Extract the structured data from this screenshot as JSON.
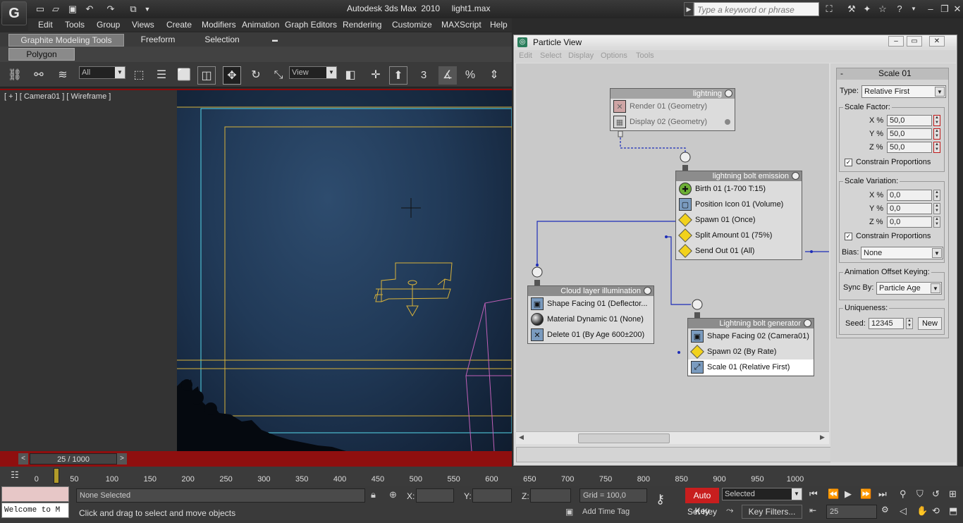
{
  "app": {
    "title": "Autodesk 3ds Max  2010     light1.max",
    "logo": "G",
    "search_placeholder": "Type a keyword or phrase"
  },
  "menu": [
    "Edit",
    "Tools",
    "Group",
    "Views",
    "Create",
    "Modifiers",
    "Animation",
    "Graph Editors",
    "Rendering",
    "Customize",
    "MAXScript",
    "Help"
  ],
  "ribbon": {
    "tabs": [
      "Graphite Modeling Tools",
      "Freeform",
      "Selection"
    ],
    "subtab": "Polygon Modeling"
  },
  "toolbar": {
    "filter_value": "All",
    "refcoord_value": "View",
    "snap_label": "3"
  },
  "viewport": {
    "label": "[ + ] [ Camera01 ] [ Wireframe ]",
    "frame_readout": "25 / 1000",
    "prev_label": "<",
    "next_label": ">"
  },
  "particle_view": {
    "title": "Particle View",
    "menu": [
      "Edit",
      "Select",
      "Display",
      "Options",
      "Tools"
    ],
    "events": [
      {
        "name": "lightning",
        "operators": [
          "Render 01 (Geometry)",
          "Display 02 (Geometry)"
        ]
      },
      {
        "name": "lightning bolt emission",
        "operators": [
          "Birth 01 (1-700 T:15)",
          "Position Icon 01 (Volume)",
          "Spawn 01 (Once)",
          "Split Amount 01 (75%)",
          "Send Out 01 (All)"
        ]
      },
      {
        "name": "Cloud layer illumination",
        "operators": [
          "Shape Facing 01 (Deflector...",
          "Material Dynamic 01 (None)",
          "Delete 01 (By Age 600±200)"
        ]
      },
      {
        "name": "Lightning bolt generator",
        "operators": [
          "Shape Facing 02 (Camera01)",
          "Spawn 02 (By Rate)",
          "Scale 01 (Relative First)"
        ]
      }
    ],
    "rollout": {
      "title": "Scale 01",
      "collapse": "-",
      "type_label": "Type:",
      "type_value": "Relative First",
      "scale_factor_label": "Scale Factor:",
      "scale_factor": [
        {
          "axis": "X %",
          "value": "50,0"
        },
        {
          "axis": "Y %",
          "value": "50,0"
        },
        {
          "axis": "Z %",
          "value": "50,0"
        }
      ],
      "constrain_label": "Constrain Proportions",
      "scale_variation_label": "Scale Variation:",
      "scale_variation": [
        {
          "axis": "X %",
          "value": "0,0"
        },
        {
          "axis": "Y %",
          "value": "0,0"
        },
        {
          "axis": "Z %",
          "value": "0,0"
        }
      ],
      "constrain2_label": "Constrain Proportions",
      "bias_label": "Bias:",
      "bias_value": "None",
      "anim_offset_label": "Animation Offset Keying:",
      "sync_label": "Sync By:",
      "sync_value": "Particle Age",
      "uniqueness_label": "Uniqueness:",
      "seed_label": "Seed:",
      "seed_value": "12345",
      "new_label": "New"
    }
  },
  "trackbar": {
    "ticks": [
      "0",
      "50",
      "100",
      "150",
      "200",
      "250",
      "300",
      "350",
      "400",
      "450",
      "500",
      "550",
      "600",
      "650",
      "700",
      "750",
      "800",
      "850",
      "900",
      "950",
      "1000"
    ]
  },
  "status": {
    "selection": "None Selected",
    "prompt": "Click and drag to select and move objects",
    "x_label": "X:",
    "y_label": "Y:",
    "z_label": "Z:",
    "grid": "Grid = 100,0",
    "add_time_tag": "Add Time Tag",
    "auto_key": "Auto Key",
    "set_key": "Set Key",
    "selected_value": "Selected",
    "key_filters": "Key Filters...",
    "frame_value": "25",
    "listener": "Welcome to M"
  },
  "colors": {
    "accent_red": "#8f0f0f",
    "auto_key": "#c81e1e"
  }
}
